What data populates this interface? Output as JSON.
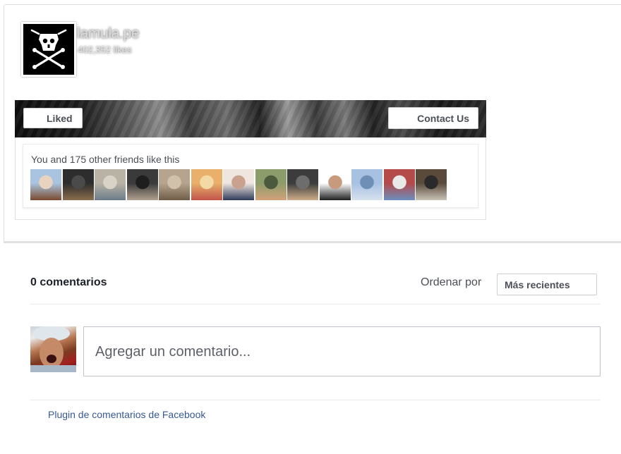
{
  "page": {
    "name": "lamula.pe",
    "likes": "402,352 likes",
    "liked_label": "Liked",
    "contact_label": "Contact Us",
    "friends_text": "You and 175 other friends like this",
    "friend_faces": [
      {
        "icon": "friend-photo",
        "colors": [
          "#a9c4e0",
          "#7b4a2e",
          "#e8d3c0"
        ]
      },
      {
        "icon": "friend-photo",
        "colors": [
          "#2d2d2d",
          "#8a6d4d",
          "#4a4a4a"
        ]
      },
      {
        "icon": "friend-photo",
        "colors": [
          "#b9b3a6",
          "#6b7b8a",
          "#d9d2c6"
        ]
      },
      {
        "icon": "friend-photo",
        "colors": [
          "#3a3a3a",
          "#b0a090",
          "#1e1e1e"
        ]
      },
      {
        "icon": "friend-photo",
        "colors": [
          "#b7a48e",
          "#6f5d47",
          "#d2c1aa"
        ]
      },
      {
        "icon": "friend-photo",
        "colors": [
          "#e8b06b",
          "#c1534a",
          "#f3d9a3"
        ]
      },
      {
        "icon": "friend-photo",
        "colors": [
          "#efe6df",
          "#2f3a5a",
          "#c9a18e"
        ]
      },
      {
        "icon": "friend-photo",
        "colors": [
          "#8c9c6a",
          "#d2a27a",
          "#4b5a3c"
        ]
      },
      {
        "icon": "friend-photo",
        "colors": [
          "#3c3c3c",
          "#cfae8a",
          "#6d6d6d"
        ]
      },
      {
        "icon": "friend-photo",
        "colors": [
          "#ffffff",
          "#1f1f1f",
          "#c79a7e"
        ]
      },
      {
        "icon": "friend-photo",
        "colors": [
          "#a7c1e2",
          "#d7e2ee",
          "#6f8fb6"
        ]
      },
      {
        "icon": "friend-photo",
        "colors": [
          "#b44a4a",
          "#6a8fbf",
          "#e9e9e9"
        ]
      },
      {
        "icon": "friend-photo",
        "colors": [
          "#5a4a3a",
          "#c9c2b7",
          "#2a2a2a"
        ]
      }
    ]
  },
  "comments": {
    "count_label": "0 comentarios",
    "sort_label": "Ordenar por",
    "sort_value": "Más recientes",
    "input_placeholder": "Agregar un comentario...",
    "plugin_link": "Plugin de comentarios de Facebook"
  }
}
